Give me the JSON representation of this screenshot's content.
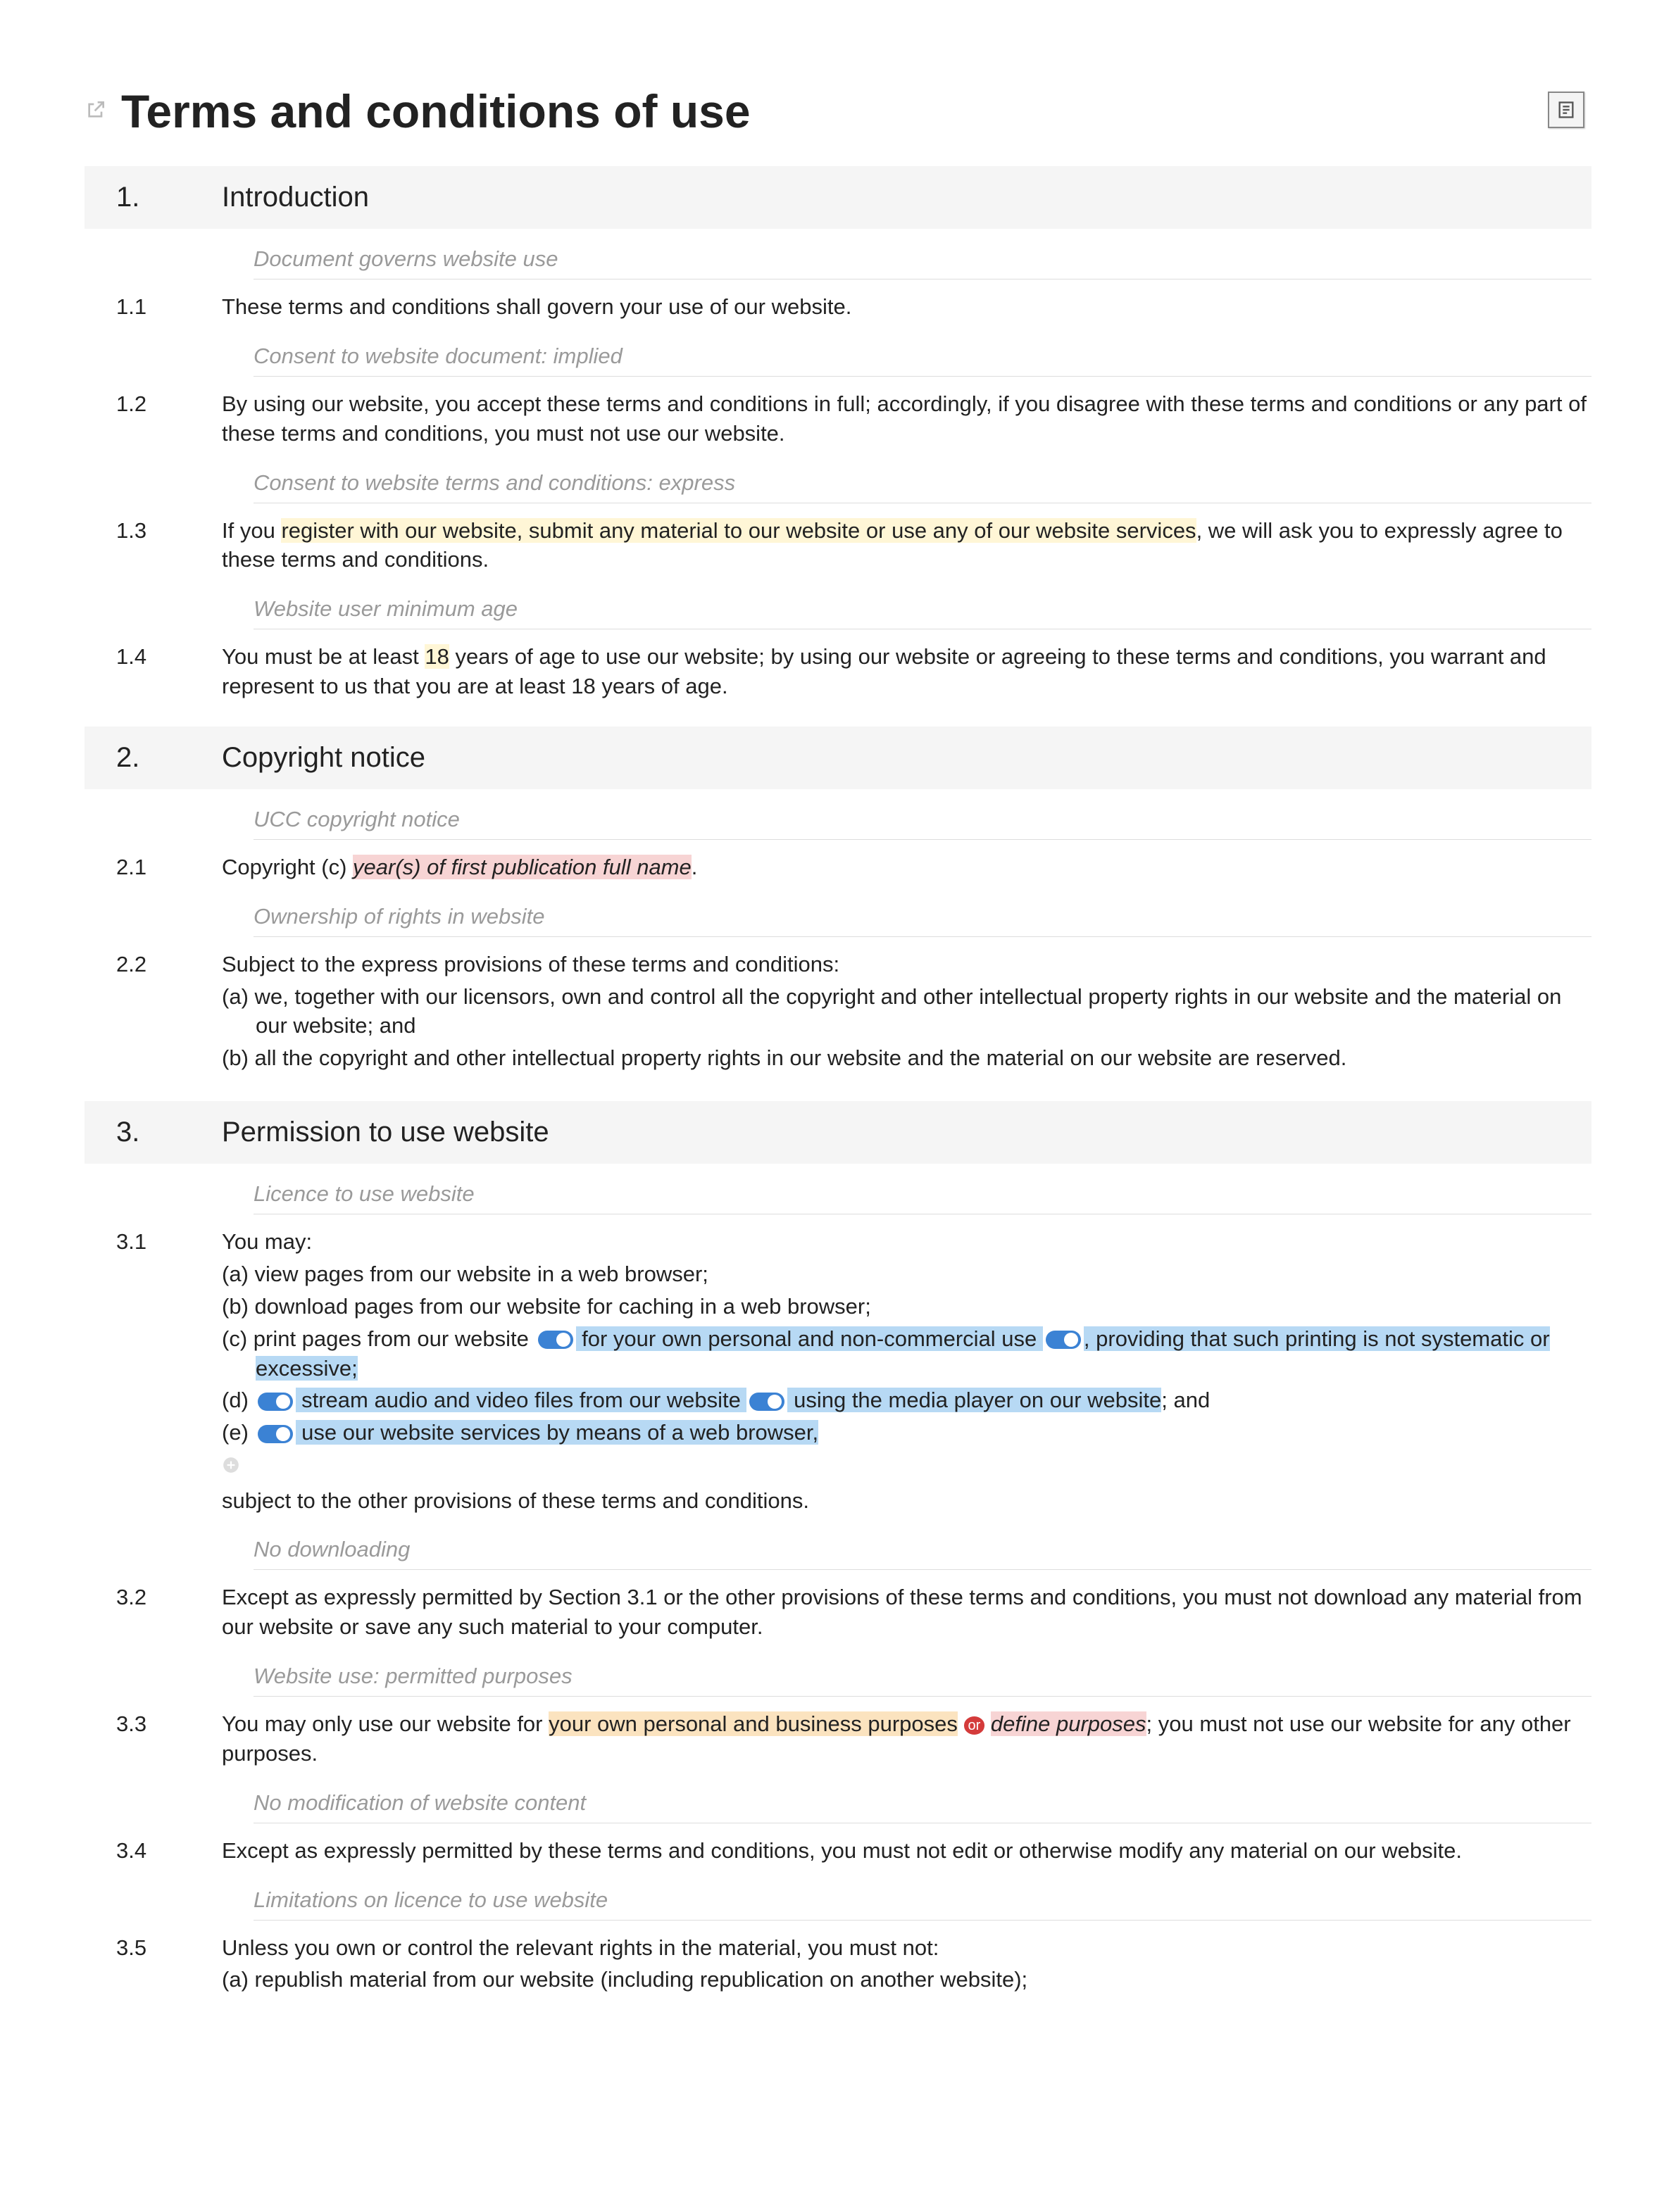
{
  "title": "Terms and conditions of use",
  "sections": {
    "s1": {
      "num": "1.",
      "title": "Introduction",
      "c1_sub": "Document governs website use",
      "c1_num": "1.1",
      "c1_txt": "These terms and conditions shall govern your use of our website.",
      "c2_sub": "Consent to website document: implied",
      "c2_num": "1.2",
      "c2_txt": "By using our website, you accept these terms and conditions in full; accordingly, if you disagree with these terms and conditions or any part of these terms and conditions, you must not use our website.",
      "c3_sub": "Consent to website terms and conditions: express",
      "c3_num": "1.3",
      "c3_pre": "If you ",
      "c3_hl": "register with our website, submit any material to our website or use any of our website services",
      "c3_post": ", we will ask you to expressly agree to these terms and conditions.",
      "c4_sub": "Website user minimum age",
      "c4_num": "1.4",
      "c4_a": "You must be at least ",
      "c4_b": "18",
      "c4_c": " years of age to use our website; by using our website or agreeing to these terms and conditions, you warrant and represent to us that you are at least 18 years of age."
    },
    "s2": {
      "num": "2.",
      "title": "Copyright notice",
      "c1_sub": "UCC copyright notice",
      "c1_num": "2.1",
      "c1_pre": "Copyright (c) ",
      "c1_hl": "year(s) of first publication full name",
      "c1_post": ".",
      "c2_sub": "Ownership of rights in website",
      "c2_num": "2.2",
      "c2_txt": "Subject to the express provisions of these terms and conditions:",
      "c2_a": "(a)  we, together with our licensors, own and control all the copyright and other intellectual property rights in our website and the material on our website; and",
      "c2_b": "(b)  all the copyright and other intellectual property rights in our website and the material on our website are reserved."
    },
    "s3": {
      "num": "3.",
      "title": "Permission to use website",
      "c1_sub": "Licence to use website",
      "c1_num": "3.1",
      "c1_txt": "You may:",
      "c1_a": "(a)  view pages from our website in a web browser;",
      "c1_b": "(b)  download pages from our website for caching in a web browser;",
      "c1_c_pre": "(c)  print pages from our website ",
      "c1_c_h1": " for your own personal and non-commercial use ",
      "c1_c_h2": ", providing that such printing is not systematic or excessive;",
      "c1_d_pre": "(d)  ",
      "c1_d_h1": " stream audio and video files from our website ",
      "c1_d_h2": " using the media player on our website",
      "c1_d_post": "; and",
      "c1_e_pre": "(e)  ",
      "c1_e_h1": " use our website services by means of a web browser,",
      "c1_after": "subject to the other provisions of these terms and conditions.",
      "c2_sub": "No downloading",
      "c2_num": "3.2",
      "c2_txt": "Except as expressly permitted by Section 3.1 or the other provisions of these terms and conditions, you must not download any material from our website or save any such material to your computer.",
      "c3_sub": "Website use: permitted purposes",
      "c3_num": "3.3",
      "c3_pre": "You may only use our website for ",
      "c3_h1": "your own personal and business purposes",
      "c3_or": "or",
      "c3_h2": "define purposes",
      "c3_post": "; you must not use our website for any other purposes.",
      "c4_sub": "No modification of website content",
      "c4_num": "3.4",
      "c4_txt": "Except as expressly permitted by these terms and conditions, you must not edit or otherwise modify any material on our website.",
      "c5_sub": "Limitations on licence to use website",
      "c5_num": "3.5",
      "c5_txt": "Unless you own or control the relevant rights in the material, you must not:",
      "c5_a": "(a)  republish material from our website (including republication on another website);"
    }
  }
}
